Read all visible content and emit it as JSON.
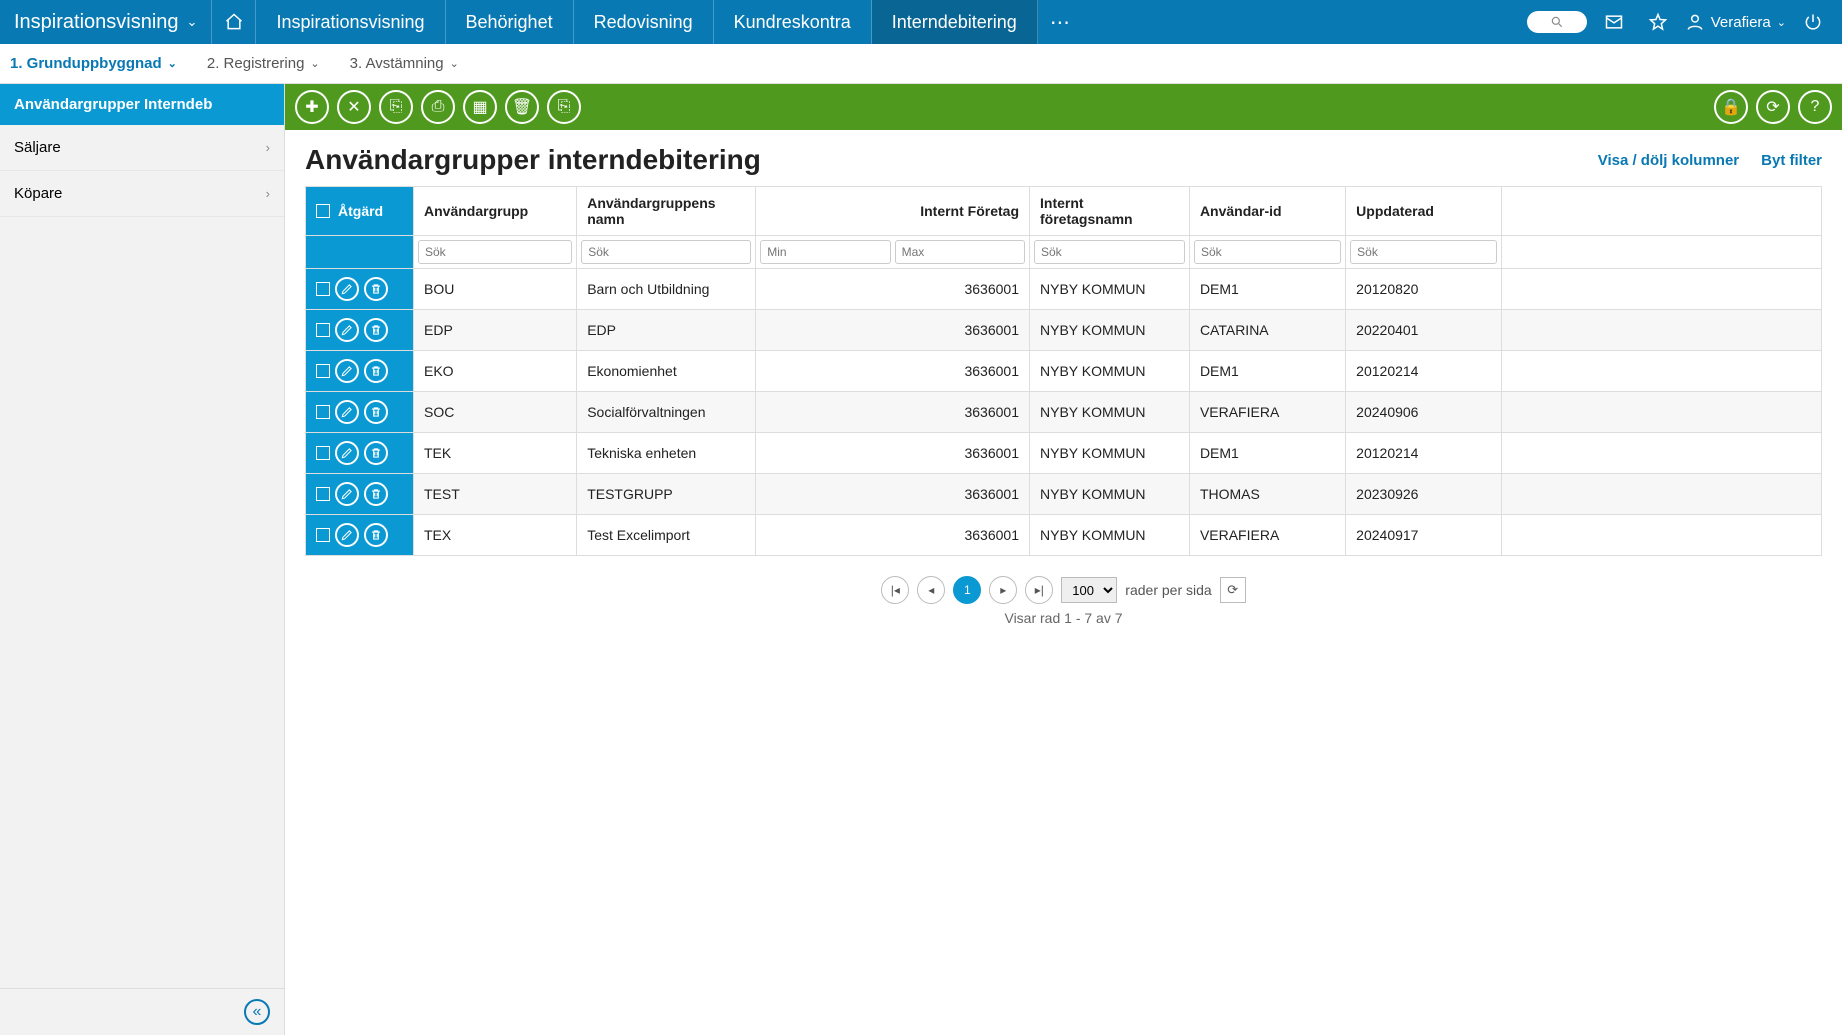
{
  "topnav": {
    "title": "Inspirationsvisning",
    "tabs": [
      "Inspirationsvisning",
      "Behörighet",
      "Redovisning",
      "Kundreskontra",
      "Interndebitering"
    ],
    "active_tab": 4,
    "user": "Verafiera"
  },
  "subnav": {
    "items": [
      "1. Grunduppbyggnad",
      "2. Registrering",
      "3. Avstämning"
    ],
    "active": 0
  },
  "sidebar": {
    "header": "Användargrupper Interndeb",
    "items": [
      "Säljare",
      "Köpare"
    ]
  },
  "page": {
    "title": "Användargrupper interndebitering",
    "link_columns": "Visa / dölj kolumner",
    "link_filter": "Byt filter"
  },
  "table": {
    "columns": {
      "action": "Åtgärd",
      "group": "Användargrupp",
      "name": "Användargruppens namn",
      "company_no": "Internt Företag",
      "company_name": "Internt företagsnamn",
      "user_id": "Användar-id",
      "updated": "Uppdaterad"
    },
    "placeholders": {
      "search": "Sök",
      "min": "Min",
      "max": "Max"
    },
    "rows": [
      {
        "group": "BOU",
        "name": "Barn och Utbildning",
        "company_no": "3636001",
        "company_name": "NYBY KOMMUN",
        "user_id": "DEM1",
        "updated": "20120820"
      },
      {
        "group": "EDP",
        "name": "EDP",
        "company_no": "3636001",
        "company_name": "NYBY KOMMUN",
        "user_id": "CATARINA",
        "updated": "20220401"
      },
      {
        "group": "EKO",
        "name": "Ekonomienhet",
        "company_no": "3636001",
        "company_name": "NYBY KOMMUN",
        "user_id": "DEM1",
        "updated": "20120214"
      },
      {
        "group": "SOC",
        "name": "Socialförvaltningen",
        "company_no": "3636001",
        "company_name": "NYBY KOMMUN",
        "user_id": "VERAFIERA",
        "updated": "20240906"
      },
      {
        "group": "TEK",
        "name": "Tekniska enheten",
        "company_no": "3636001",
        "company_name": "NYBY KOMMUN",
        "user_id": "DEM1",
        "updated": "20120214"
      },
      {
        "group": "TEST",
        "name": "TESTGRUPP",
        "company_no": "3636001",
        "company_name": "NYBY KOMMUN",
        "user_id": "THOMAS",
        "updated": "20230926"
      },
      {
        "group": "TEX",
        "name": "Test Excelimport",
        "company_no": "3636001",
        "company_name": "NYBY KOMMUN",
        "user_id": "VERAFIERA",
        "updated": "20240917"
      }
    ]
  },
  "pagination": {
    "current": "1",
    "page_size": "100",
    "label": "rader per sida",
    "info": "Visar rad 1 - 7 av 7"
  }
}
